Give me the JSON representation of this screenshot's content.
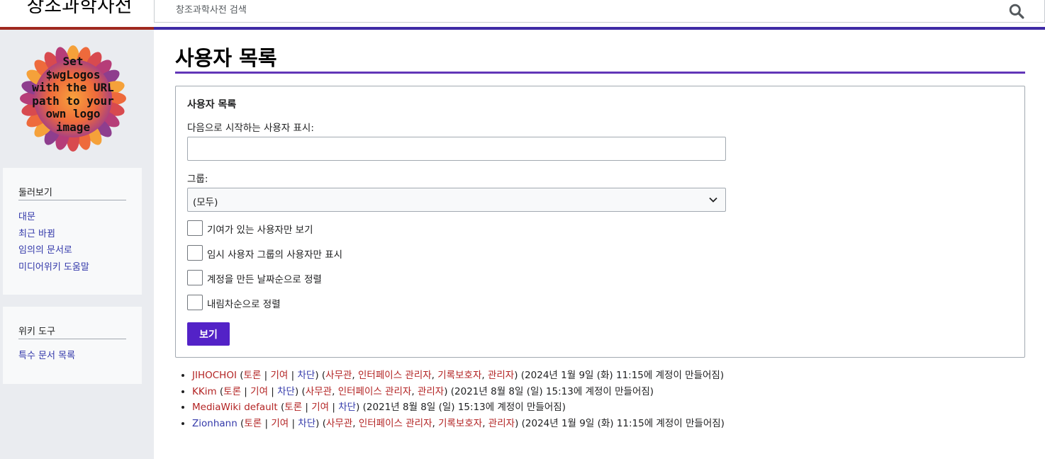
{
  "site": {
    "title": "창조과학사전"
  },
  "logo": {
    "text_lines": [
      "Set",
      "$wgLogos",
      "with the URL",
      "path to your",
      "own logo",
      "image"
    ]
  },
  "search": {
    "placeholder": "창조과학사전 검색"
  },
  "sidebar": {
    "navigation": {
      "heading": "둘러보기",
      "items": [
        {
          "label": "대문"
        },
        {
          "label": "최근 바뀜"
        },
        {
          "label": "임의의 문서로"
        },
        {
          "label": "미디어위키 도움말"
        }
      ]
    },
    "tools": {
      "heading": "위키 도구",
      "items": [
        {
          "label": "특수 문서 목록"
        }
      ]
    }
  },
  "page": {
    "title": "사용자 목록"
  },
  "form": {
    "legend": "사용자 목록",
    "start_label": "다음으로 시작하는 사용자 표시:",
    "start_value": "",
    "group_label": "그룹:",
    "group_selected": "(모두)",
    "checkboxes": [
      {
        "label": "기여가 있는 사용자만 보기",
        "checked": false
      },
      {
        "label": "임시 사용자 그룹의 사용자만 표시",
        "checked": false
      },
      {
        "label": "계정을 만든 날짜순으로 정렬",
        "checked": false
      },
      {
        "label": "내림차순으로 정렬",
        "checked": false
      }
    ],
    "submit_label": "보기"
  },
  "link_labels": {
    "talk": "토론",
    "contribs": "기여",
    "block": "차단"
  },
  "results": [
    {
      "name": "JIHOCHOI",
      "name_color": "#b32424",
      "groups": [
        {
          "label": "사무관"
        },
        {
          "label": "인터페이스 관리자"
        },
        {
          "label": "기록보호자"
        },
        {
          "label": "관리자"
        }
      ],
      "created": "(2024년 1월 9일 (화) 11:15에 계정이 만들어짐)"
    },
    {
      "name": "KKim",
      "name_color": "#b32424",
      "groups": [
        {
          "label": "사무관"
        },
        {
          "label": "인터페이스 관리자"
        },
        {
          "label": "관리자"
        }
      ],
      "created": "(2021년 8월 8일 (일) 15:13에 계정이 만들어짐)"
    },
    {
      "name": "MediaWiki default",
      "name_color": "#b32424",
      "groups": [],
      "created": "(2021년 8월 8일 (일) 15:13에 계정이 만들어짐)"
    },
    {
      "name": "Zionhann",
      "name_color": "#3339aa",
      "groups": [
        {
          "label": "사무관"
        },
        {
          "label": "인터페이스 관리자"
        },
        {
          "label": "기록보호자"
        },
        {
          "label": "관리자"
        }
      ],
      "created": "(2024년 1월 9일 (화) 11:15에 계정이 만들어짐)"
    }
  ],
  "colors": {
    "accent": "#5322c7",
    "title_rule": "#6236b8",
    "red_link": "#b32424",
    "link": "#3339aa"
  }
}
